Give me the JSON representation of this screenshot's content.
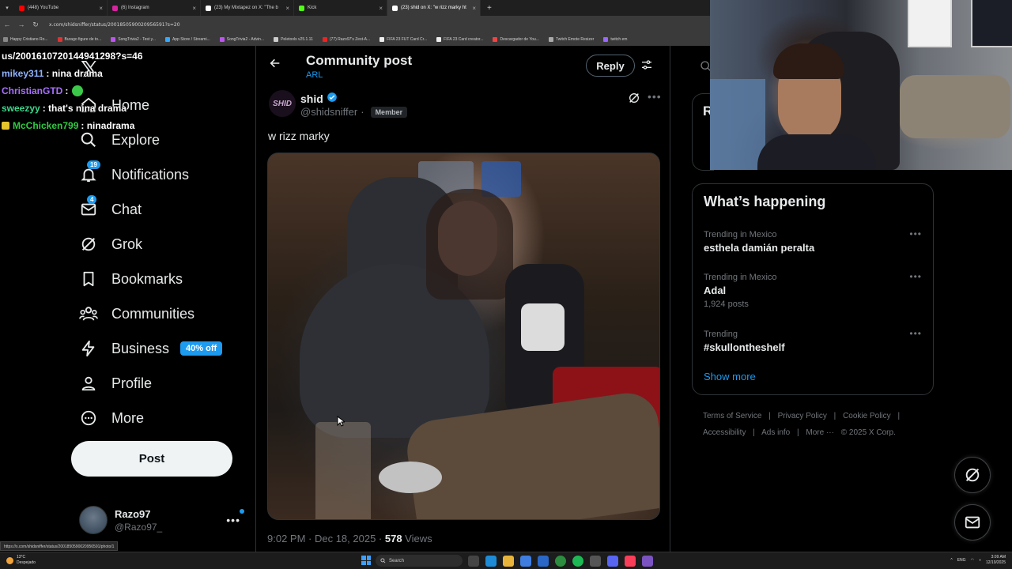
{
  "browser": {
    "tabs": [
      {
        "label": "(448) YouTube",
        "color": "#ff0000",
        "active": false
      },
      {
        "label": "(6) Instagram",
        "color": "#d6249f",
        "active": false
      },
      {
        "label": "(23) My Mixtapez on X: \"The b",
        "color": "#ffffff",
        "active": false
      },
      {
        "label": "Kick",
        "color": "#53fc18",
        "active": false
      },
      {
        "label": "(23) shid on X: \"w rizz marky ht",
        "color": "#ffffff",
        "active": true
      }
    ],
    "new_tab": "+",
    "url": "x.com/shidsniffer/status/2001850590020956591?s=20",
    "bookmarks": [
      "Happy Cristiano Ro...",
      "Burago figure de to...",
      "SongTrivia2 - Test y...",
      "App Store / Streami...",
      "SongTrivia2 - Advin...",
      "Peletools v25.1.11",
      "(77) Razo97's Zest-A...",
      "FIFA 23 FUT Card Cr...",
      "FIFA 23 Card creator...",
      "Descargador de You...",
      "Twitch Emote Resizer",
      "twitch em"
    ]
  },
  "chat": [
    {
      "user": "",
      "message": "us/2001610720144941298?s=46",
      "color": "#ffffff",
      "badge": false
    },
    {
      "user": "mikey311",
      "message": ": nina drama",
      "color": "#8fb3ff",
      "badge": false
    },
    {
      "user": "ChristianGTD",
      "message": ":",
      "color": "#a970ff",
      "badge": false,
      "emote": true
    },
    {
      "user": "sweezyy",
      "message": ": that's nina drama",
      "color": "#3dd68c",
      "badge": false
    },
    {
      "user": "McChicken799",
      "message": ": ninadrama",
      "color": "#2ecc40",
      "badge": true
    }
  ],
  "nav": {
    "items": [
      {
        "label": "Home",
        "icon": "home-icon"
      },
      {
        "label": "Explore",
        "icon": "search-icon"
      },
      {
        "label": "Notifications",
        "icon": "bell-icon",
        "badge": "19"
      },
      {
        "label": "Chat",
        "icon": "mail-icon",
        "badge": "4"
      },
      {
        "label": "Grok",
        "icon": "grok-icon"
      },
      {
        "label": "Bookmarks",
        "icon": "bookmark-icon"
      },
      {
        "label": "Communities",
        "icon": "communities-icon"
      },
      {
        "label": "Business",
        "icon": "lightning-icon",
        "promo": "40% off"
      },
      {
        "label": "Profile",
        "icon": "person-icon"
      },
      {
        "label": "More",
        "icon": "more-circle-icon"
      }
    ],
    "post_button": "Post",
    "profile": {
      "name": "Razo97",
      "handle": "@Razo97_",
      "more": "•••"
    }
  },
  "main": {
    "title": "Community post",
    "subtitle": "ARL",
    "reply_button": "Reply",
    "post": {
      "avatar_text": "SHID",
      "author": "shid",
      "handle": "@shidsniffer",
      "separator": "·",
      "member_badge": "Member",
      "text": "w rizz marky",
      "time": "9:02 PM · Dec 18, 2025 · ",
      "views_count": "578",
      "views_label": " Views",
      "more": "•••"
    }
  },
  "right": {
    "top_card_letter": "R",
    "trends_title": "What’s happening",
    "trends": [
      {
        "context": "Trending in Mexico",
        "name": "esthela damián peralta",
        "count": ""
      },
      {
        "context": "Trending in Mexico",
        "name": "Adal",
        "count": "1,924 posts"
      },
      {
        "context": "Trending",
        "name": "#skullontheshelf",
        "count": ""
      }
    ],
    "trend_more": "•••",
    "show_more": "Show more",
    "footer": [
      "Terms of Service",
      "|",
      "Privacy Policy",
      "|",
      "Cookie Policy",
      "|",
      "Accessibility",
      "|",
      "Ads info",
      "|",
      "More ···",
      "© 2025 X Corp."
    ]
  },
  "status_url": "https://x.com/shidsniffer/status/2001850590020956591/photo/1",
  "taskbar": {
    "weather_temp": "13°C",
    "weather_desc": "Despejado",
    "search_label": "Search",
    "lang": "ENG",
    "time": "3:09 AM",
    "date": "12/19/2025"
  }
}
